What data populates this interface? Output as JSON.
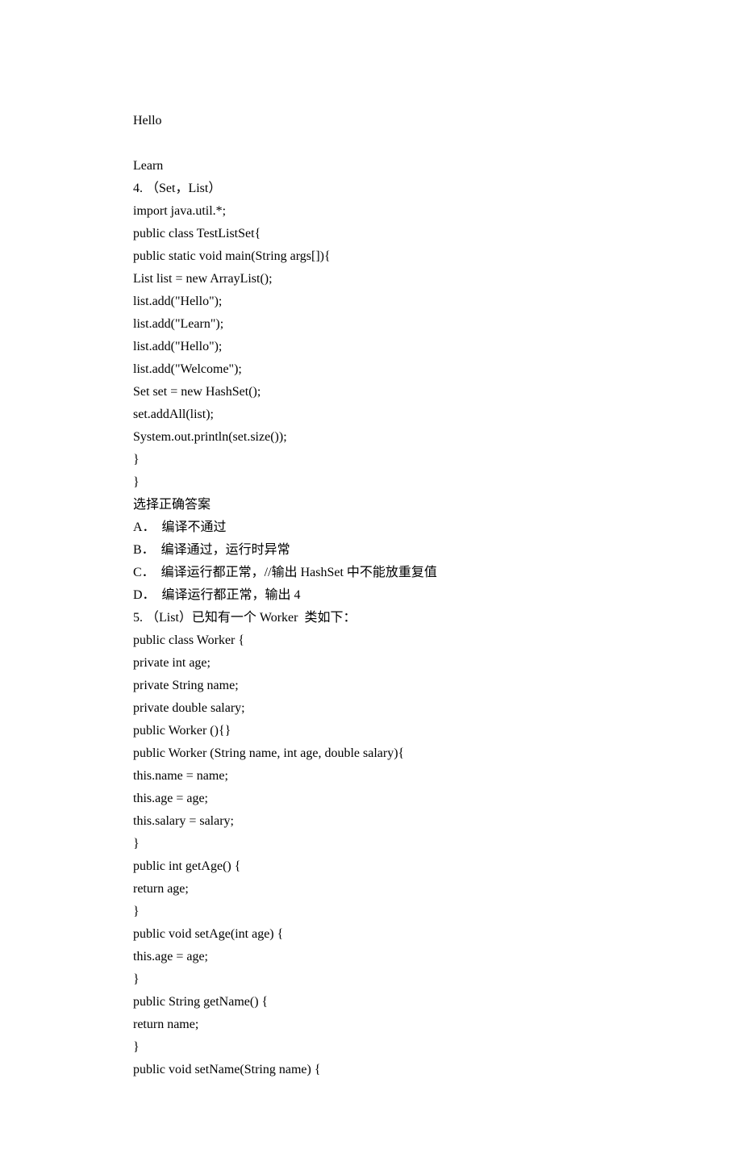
{
  "content": {
    "lines": [
      "Hello",
      "",
      "Learn",
      "4. （Set，List）",
      "import java.util.*;",
      "public class TestListSet{",
      "public static void main(String args[]){",
      "List list = new ArrayList();",
      "list.add(\"Hello\");",
      "list.add(\"Learn\");",
      "list.add(\"Hello\");",
      "list.add(\"Welcome\");",
      "Set set = new HashSet();",
      "set.addAll(list);",
      "System.out.println(set.size());",
      "}",
      "}",
      "选择正确答案",
      "A．  编译不通过",
      "B．  编译通过，运行时异常",
      "C．  编译运行都正常，//输出 HashSet 中不能放重复值",
      "D．  编译运行都正常，输出 4",
      "5. （List）已知有一个 Worker  类如下：",
      "public class Worker {",
      "private int age;",
      "private String name;",
      "private double salary;",
      "public Worker (){}",
      "public Worker (String name, int age, double salary){",
      "this.name = name;",
      "this.age = age;",
      "this.salary = salary;",
      "}",
      "public int getAge() {",
      "return age;",
      "}",
      "public void setAge(int age) {",
      "this.age = age;",
      "}",
      "public String getName() {",
      "return name;",
      "}",
      "public void setName(String name) {"
    ]
  }
}
